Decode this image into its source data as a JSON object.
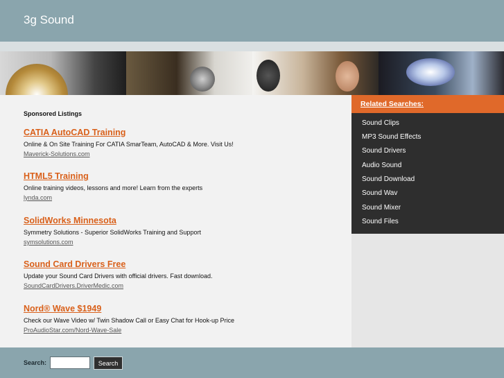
{
  "header": {
    "site_title": "3g Sound"
  },
  "main": {
    "sponsored_heading": "Sponsored Listings",
    "listings": [
      {
        "title": "CATIA AutoCAD Training",
        "description": "Online & On Site Training For CATIA SmarTeam, AutoCAD & More. Visit Us!",
        "url": "Maverick-Solutions.com"
      },
      {
        "title": "HTML5 Training",
        "description": "Online training videos, lessons and more! Learn from the experts",
        "url": "lynda.com"
      },
      {
        "title": "SolidWorks Minnesota",
        "description": "Symmetry Solutions - Superior SolidWorks Training and Support",
        "url": "symsolutions.com"
      },
      {
        "title": "Sound Card Drivers Free",
        "description": "Update your Sound Card Drivers with official drivers. Fast download.",
        "url": "SoundCardDrivers.DriverMedic.com"
      },
      {
        "title": "Nord® Wave $1949",
        "description": "Check our Wave Video w/ Twin Shadow Call or Easy Chat for Hook-up Price",
        "url": "ProAudioStar.com/Nord-Wave-Sale"
      }
    ]
  },
  "sidebar": {
    "related_title": "Related Searches:",
    "items": [
      "Sound Clips",
      "MP3 Sound Effects",
      "Sound Drivers",
      "Audio Sound",
      "Sound Download",
      "Sound Wav",
      "Sound Mixer",
      "Sound Files"
    ]
  },
  "footer": {
    "search_label": "Search:",
    "search_value": "",
    "search_button": "Search"
  },
  "colors": {
    "header_bg": "#8aa5ad",
    "accent": "#d9601a",
    "related_header_bg": "#e0692a",
    "related_list_bg": "#2e2e2e",
    "page_bg": "#f2f2f2"
  }
}
